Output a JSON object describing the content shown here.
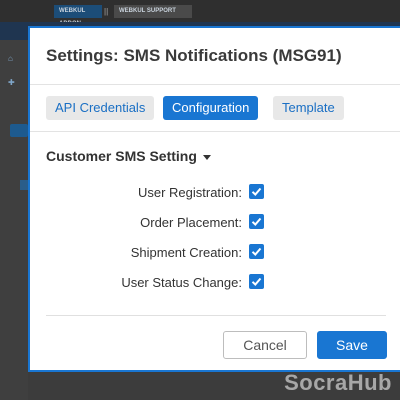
{
  "background": {
    "top_tabs": [
      "WEBKUL ADDON",
      "WEBKUL SUPPORT"
    ],
    "separator": "||",
    "watermark": "SocraHub"
  },
  "modal": {
    "title": "Settings: SMS Notifications (MSG91)",
    "tabs": [
      {
        "label": "API Credentials",
        "active": false
      },
      {
        "label": "Configuration",
        "active": true
      },
      {
        "label": "Template",
        "active": false
      }
    ],
    "section": {
      "title": "Customer SMS Setting",
      "icon": "caret-down-icon"
    },
    "fields": [
      {
        "label": "User Registration:",
        "checked": true
      },
      {
        "label": "Order Placement:",
        "checked": true
      },
      {
        "label": "Shipment Creation:",
        "checked": true
      },
      {
        "label": "User Status Change:",
        "checked": true
      }
    ],
    "buttons": {
      "cancel": "Cancel",
      "save": "Save"
    }
  },
  "colors": {
    "accent": "#1976d2",
    "tab_inactive_bg": "#e8e8e8",
    "overlay": "#3c3c3c"
  }
}
